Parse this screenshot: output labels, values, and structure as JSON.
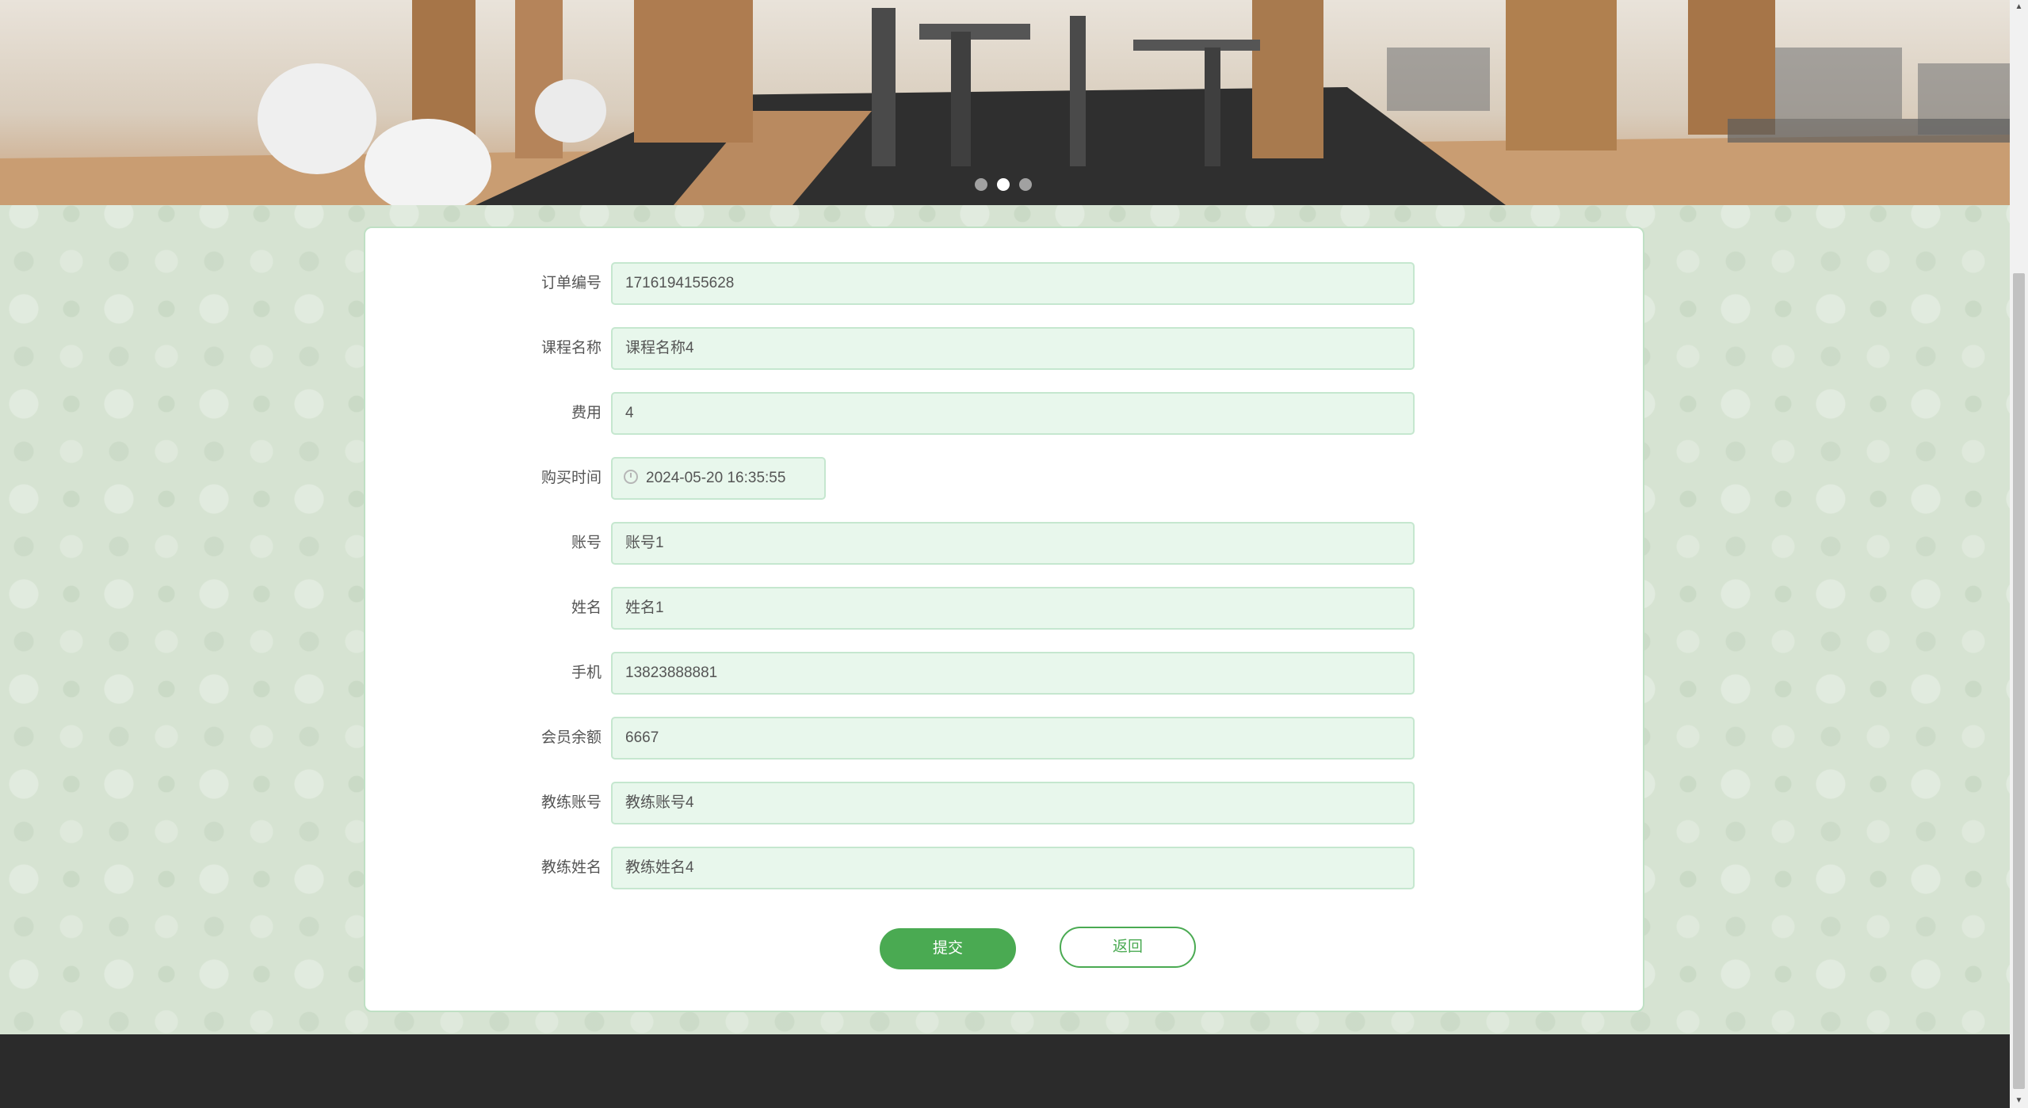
{
  "banner": {
    "slides": 3,
    "active_slide": 2
  },
  "form": {
    "fields": [
      {
        "label": "订单编号",
        "value": "1716194155628"
      },
      {
        "label": "课程名称",
        "value": "课程名称4"
      },
      {
        "label": "费用",
        "value": "4"
      },
      {
        "label": "购买时间",
        "value": "2024-05-20 16:35:55"
      },
      {
        "label": "账号",
        "value": "账号1"
      },
      {
        "label": "姓名",
        "value": "姓名1"
      },
      {
        "label": "手机",
        "value": "13823888881"
      },
      {
        "label": "会员余额",
        "value": "6667"
      },
      {
        "label": "教练账号",
        "value": "教练账号4"
      },
      {
        "label": "教练姓名",
        "value": "教练姓名4"
      }
    ],
    "submit_label": "提交",
    "back_label": "返回"
  },
  "colors": {
    "accent": "#4aaa52",
    "field_bg": "#e8f7ec",
    "page_bg": "#d6e3d2",
    "footer_bg": "#2b2b2b"
  }
}
